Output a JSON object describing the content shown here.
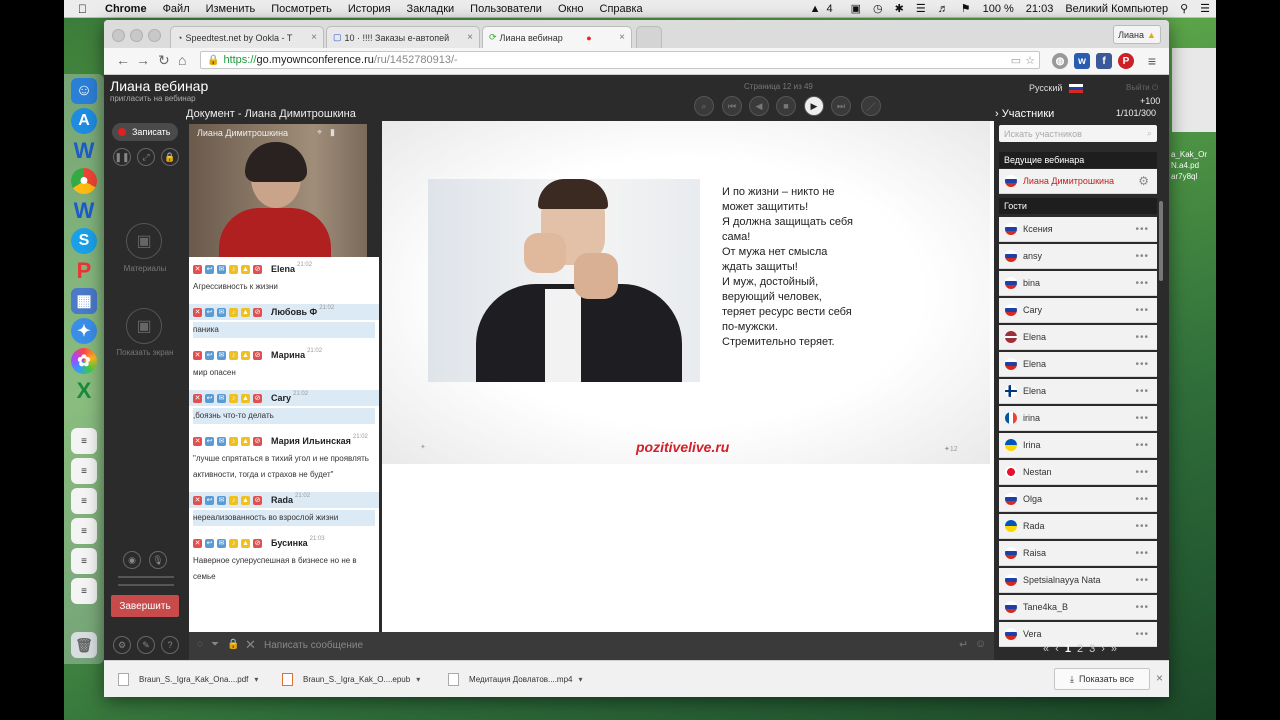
{
  "menubar": {
    "apple": "",
    "app": "Chrome",
    "items": [
      "Файл",
      "Изменить",
      "Посмотреть",
      "История",
      "Закладки",
      "Пользователи",
      "Окно",
      "Справка"
    ],
    "status": {
      "battery": "100 %",
      "time": "21:03",
      "user": "Великий Компьютер",
      "extra": "4"
    }
  },
  "browser": {
    "tabs": [
      {
        "title": "Speedtest.net by Ookla - T"
      },
      {
        "title": "10 · !!!! Заказы e-автопей"
      },
      {
        "title": "Лиана вебинар"
      }
    ],
    "profile": "Лиана",
    "url": {
      "scheme": "https://",
      "host": "go.myownconference.ru",
      "path": "/ru/1452780913/-"
    }
  },
  "app": {
    "title": "Лиана вебинар",
    "subtitle": "пригласить на вебинар",
    "page_info": "Страница 12 из 49",
    "language": "Русский",
    "exit": "Выйти",
    "document_title": "Документ - Лиана Димитрошкина",
    "participants_heading": "Участники",
    "plus": "+100",
    "count": "1/101/300",
    "record_button": "Записать",
    "materials_label": "Материалы",
    "screen_share_label": "Показать экран",
    "finish_button": "Завершить",
    "video_name": "Лиана  Димитрошкина",
    "chat_placeholder": "Написать сообщение",
    "search_placeholder": "Искать участников"
  },
  "slide": {
    "lines": [
      "И по жизни – никто не",
      "может защитить!",
      "Я должна защищать себя",
      "сама!",
      "От мужа нет смысла",
      "ждать защиты!",
      "И муж, достойный,",
      "верующий человек,",
      "теряет ресурс вести себя",
      "по-мужски.",
      "Стремительно теряет."
    ],
    "site": "pozitivelive.ru",
    "number": "12"
  },
  "chat": {
    "messages": [
      {
        "author": "Elena",
        "time": "21:02",
        "text": "Агрессивность к жизни",
        "highlight": false
      },
      {
        "author": "Любовь Ф",
        "time": "21:02",
        "text": "паника",
        "highlight": true
      },
      {
        "author": "Марина",
        "time": "21:02",
        "text": "мир опасен",
        "highlight": false
      },
      {
        "author": "Cary",
        "time": "21:02",
        "text": ",боязнь что-то делать",
        "highlight": true
      },
      {
        "author": "Мария Ильинская",
        "time": "21:02",
        "text": "\"лучше спрятаться в тихий угол и не проявлять активности, тогда и страхов не будет\"",
        "highlight": false
      },
      {
        "author": "Rada",
        "time": "21:02",
        "text": "нереализованность во взрослой жизни",
        "highlight": true
      },
      {
        "author": "Бусинка",
        "time": "21:03",
        "text": "Наверное суперуспешная в бизнесе но не в семье",
        "highlight": false
      }
    ]
  },
  "participants": {
    "hosts_label": "Ведущие вебинара",
    "guests_label": "Гости",
    "host": {
      "name": "Лиана Димитрошкина",
      "flag": "ru"
    },
    "guests": [
      {
        "name": "Ксения",
        "flag": "ru"
      },
      {
        "name": "ansy",
        "flag": "ru"
      },
      {
        "name": "bina",
        "flag": "ru"
      },
      {
        "name": "Cary",
        "flag": "ru"
      },
      {
        "name": "Elena",
        "flag": "lv"
      },
      {
        "name": "Elena",
        "flag": "ru"
      },
      {
        "name": "Elena",
        "flag": "fi"
      },
      {
        "name": "irina",
        "flag": "fr"
      },
      {
        "name": "Irina",
        "flag": "ua"
      },
      {
        "name": "Nestan",
        "flag": "ge"
      },
      {
        "name": "Olga",
        "flag": "ru"
      },
      {
        "name": "Rada",
        "flag": "ua"
      },
      {
        "name": "Raisa",
        "flag": "ru"
      },
      {
        "name": "Spetsialnayya Nata",
        "flag": "ru"
      },
      {
        "name": "Tane4ka_B",
        "flag": "ru"
      },
      {
        "name": "Vera",
        "flag": "ru"
      }
    ],
    "pager": {
      "pages": [
        "1",
        "2",
        "3"
      ],
      "current": "1",
      "first": "«",
      "prev": "‹",
      "next": "›",
      "last": "»"
    }
  },
  "downloads": {
    "items": [
      {
        "name": "Braun_S._Igra_Kak_Ona....pdf"
      },
      {
        "name": "Braun_S._Igra_Kak_O....epub"
      },
      {
        "name": "Медитация Довлатов....mp4"
      }
    ],
    "show_all": "Показать все"
  },
  "desktop_files": [
    "a_Kak_Or",
    "N.a4.pd",
    "ar7y8ql"
  ],
  "colors": {
    "accent_red": "#c84b4b",
    "link_green": "#1a9a3a",
    "site_red": "#d21f2a",
    "dark_bg": "#2b2b2b"
  }
}
